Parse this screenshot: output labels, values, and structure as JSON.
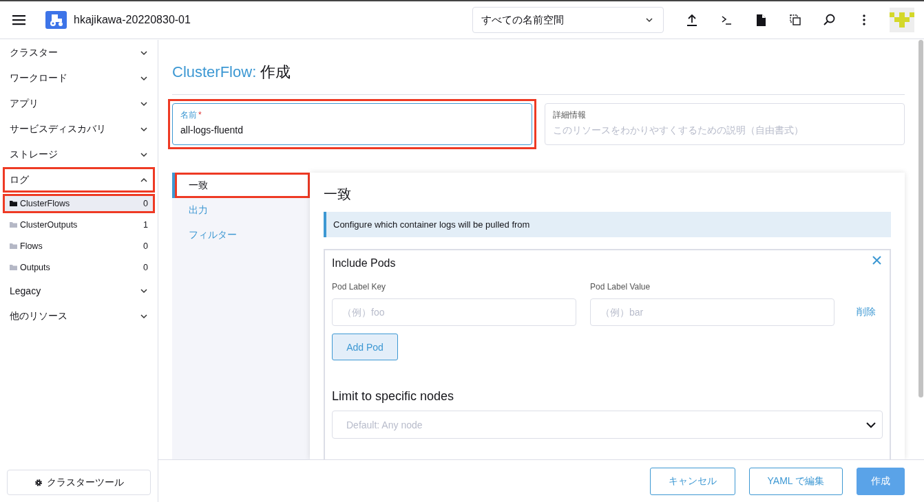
{
  "header": {
    "cluster_name": "hkajikawa-20220830-01",
    "namespace_select": "すべての名前空間"
  },
  "sidebar": {
    "groups": [
      {
        "label": "クラスター",
        "expanded": false,
        "highlighted": false
      },
      {
        "label": "ワークロード",
        "expanded": false,
        "highlighted": false
      },
      {
        "label": "アプリ",
        "expanded": false,
        "highlighted": false
      },
      {
        "label": "サービスディスカバリ",
        "expanded": false,
        "highlighted": false
      },
      {
        "label": "ストレージ",
        "expanded": false,
        "highlighted": false
      },
      {
        "label": "ログ",
        "expanded": true,
        "highlighted": true,
        "children": [
          {
            "label": "ClusterFlows",
            "count": "0",
            "selected": true,
            "highlighted": true
          },
          {
            "label": "ClusterOutputs",
            "count": "1",
            "selected": false,
            "highlighted": false
          },
          {
            "label": "Flows",
            "count": "0",
            "selected": false,
            "highlighted": false
          },
          {
            "label": "Outputs",
            "count": "0",
            "selected": false,
            "highlighted": false
          }
        ]
      },
      {
        "label": "Legacy",
        "expanded": false,
        "highlighted": false
      },
      {
        "label": "他のリソース",
        "expanded": false,
        "highlighted": false
      }
    ],
    "tools_button": "クラスターツール"
  },
  "page": {
    "title_type": "ClusterFlow:",
    "title_action": "作成",
    "name_field": {
      "label": "名前",
      "required_mark": "*",
      "value": "all-logs-fluentd",
      "highlighted": true
    },
    "description_field": {
      "label": "詳細情報",
      "placeholder": "このリソースをわかりやすくするための説明（自由書式）"
    },
    "tabs": [
      {
        "label": "一致",
        "selected": true,
        "highlighted": true
      },
      {
        "label": "出力",
        "selected": false,
        "highlighted": false
      },
      {
        "label": "フィルター",
        "selected": false,
        "highlighted": false
      }
    ],
    "section": {
      "title": "一致",
      "banner": "Configure which container logs will be pulled from",
      "rule": {
        "title": "Include Pods",
        "key_label": "Pod Label Key",
        "value_label": "Pod Label Value",
        "key_placeholder": "（例）foo",
        "value_placeholder": "（例）bar",
        "remove_link": "削除",
        "add_button": "Add Pod",
        "nodes_title": "Limit to specific nodes",
        "nodes_placeholder": "Default: Any node"
      }
    }
  },
  "footer": {
    "buttons": [
      {
        "label": "キャンセル",
        "kind": "outline"
      },
      {
        "label": "YAML で編集",
        "kind": "outline"
      },
      {
        "label": "作成",
        "kind": "primary"
      }
    ]
  }
}
